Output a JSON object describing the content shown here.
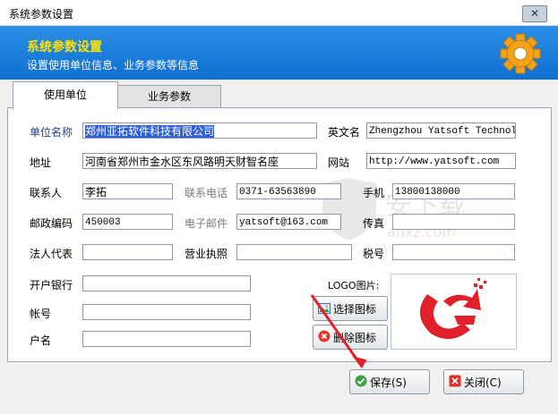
{
  "window": {
    "title": "系统参数设置",
    "close": "✕"
  },
  "header": {
    "title": "系统参数设置",
    "subtitle": "设置使用单位信息、业务参数等信息"
  },
  "tabs": [
    {
      "label": "使用单位"
    },
    {
      "label": "业务参数"
    }
  ],
  "form": {
    "company_name": {
      "label": "单位名称",
      "value": "郑州亚拓软件科技有限公司"
    },
    "english_name": {
      "label": "英文名",
      "value": "Zhengzhou Yatsoft Technolog"
    },
    "address": {
      "label": "地址",
      "value": "河南省郑州市金水区东风路明天财智名座"
    },
    "website": {
      "label": "网站",
      "value": "http://www.yatsoft.com"
    },
    "contact": {
      "label": "联系人",
      "value": "李拓"
    },
    "phone": {
      "label": "联系电话",
      "value": "0371-63563890"
    },
    "mobile": {
      "label": "手机",
      "value": "13800138000"
    },
    "postcode": {
      "label": "邮政编码",
      "value": "450003"
    },
    "email": {
      "label": "电子邮件",
      "value": "yatsoft@163.com"
    },
    "fax": {
      "label": "传真",
      "value": ""
    },
    "legal_rep": {
      "label": "法人代表",
      "value": ""
    },
    "license": {
      "label": "营业执照",
      "value": ""
    },
    "tax_no": {
      "label": "税号",
      "value": ""
    },
    "bank": {
      "label": "开户银行",
      "value": ""
    },
    "account": {
      "label": "帐号",
      "value": ""
    },
    "account_name": {
      "label": "户名",
      "value": ""
    },
    "logo_label": "LOGO图片:"
  },
  "buttons": {
    "choose_icon": "选择图标",
    "delete_icon": "删除图标",
    "save": "保存(S)",
    "close": "关闭(C)"
  },
  "watermark": {
    "text": "安下载",
    "sub": "anxz.com"
  },
  "colors": {
    "banner": "#1a7ddc",
    "header_title": "#ffe400",
    "label_blue": "#1c3f95",
    "selection": "#2f5fd8",
    "logo_red": "#e0202a"
  }
}
